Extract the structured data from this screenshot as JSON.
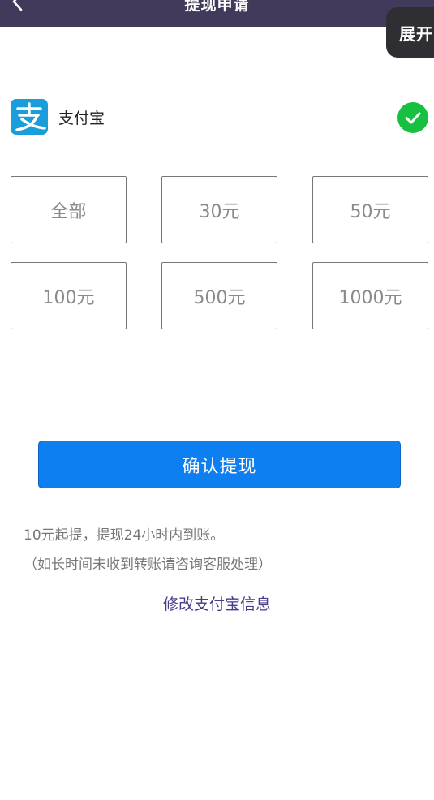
{
  "header": {
    "title": "提现申请",
    "expand_label": "展开"
  },
  "payment_method": {
    "name": "支付宝",
    "selected": true
  },
  "amount_options": [
    {
      "label": "全部"
    },
    {
      "label": "30元"
    },
    {
      "label": "50元"
    },
    {
      "label": "100元"
    },
    {
      "label": "500元"
    },
    {
      "label": "1000元"
    }
  ],
  "confirm_button": "确认提现",
  "notes": [
    "10元起提，提现24小时内到账。",
    "（如长时间未收到转账请咨询客服处理）"
  ],
  "modify_link": "修改支付宝信息",
  "colors": {
    "header_bg": "#413a5b",
    "primary": "#0e7ff0",
    "alipay_blue": "#1a9ddb",
    "check_green": "#17c041",
    "link": "#4a3a8c"
  }
}
